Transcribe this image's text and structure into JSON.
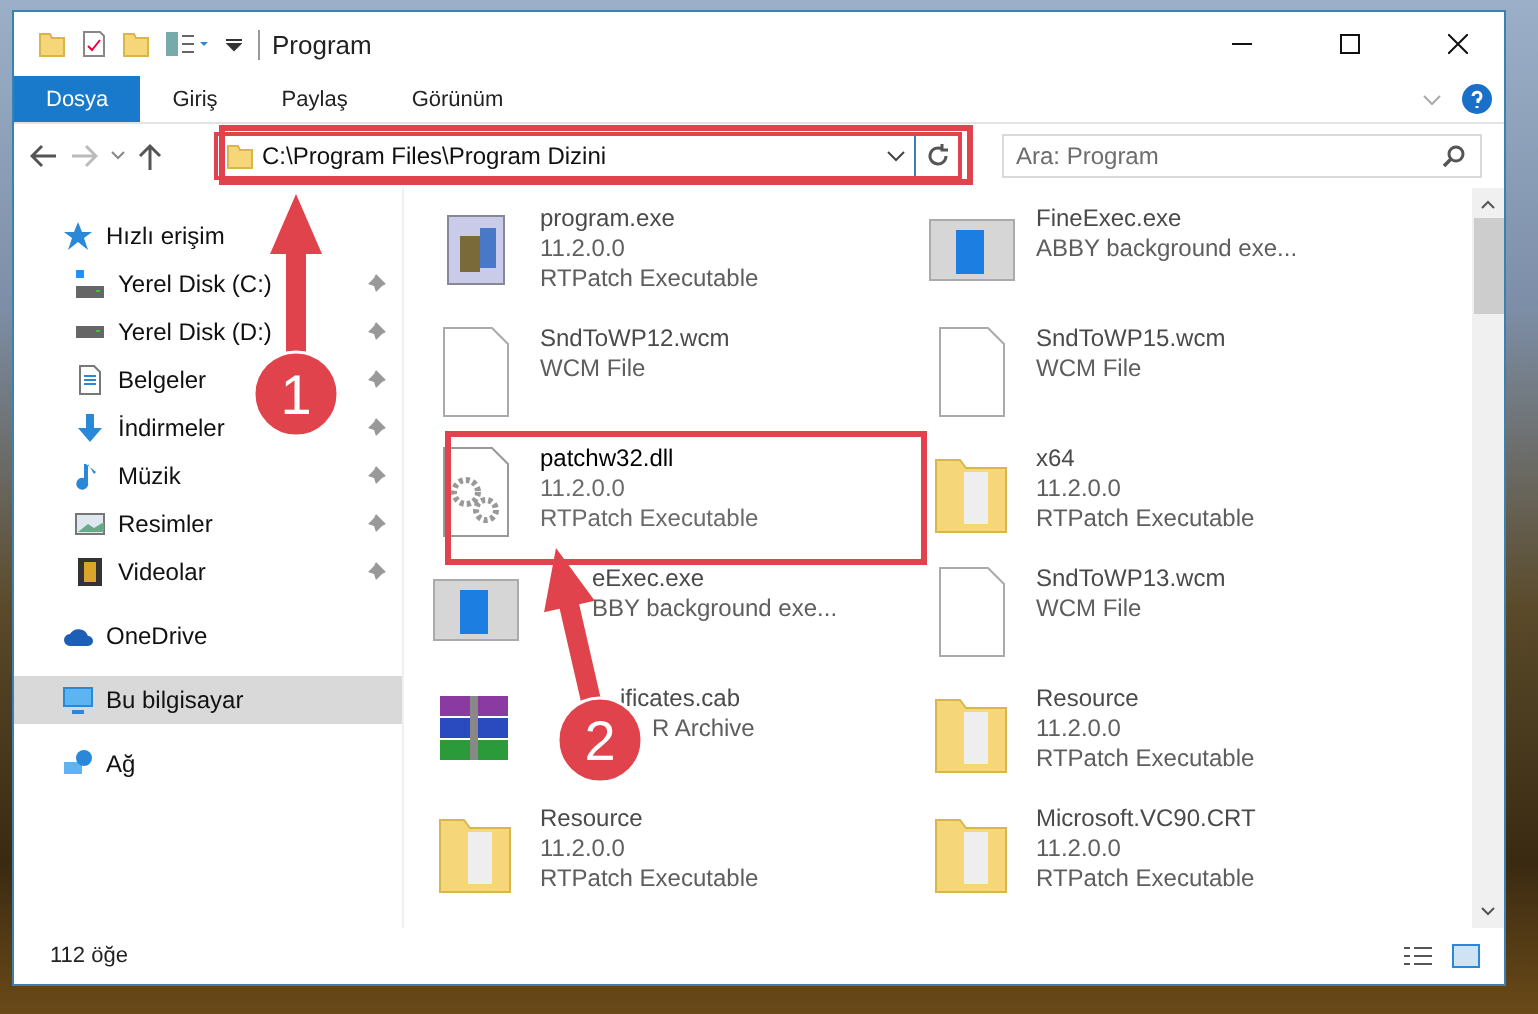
{
  "window": {
    "title": "Program"
  },
  "ribbon_tabs": [
    {
      "label": "Dosya",
      "selected": true
    },
    {
      "label": "Giriş",
      "selected": false
    },
    {
      "label": "Paylaş",
      "selected": false
    },
    {
      "label": "Görünüm",
      "selected": false
    }
  ],
  "address_bar": {
    "path": "C:\\Program Files\\Program Dizini"
  },
  "search": {
    "placeholder": "Ara: Program"
  },
  "sidebar": {
    "items": [
      {
        "label": "Hızlı erişim",
        "kind": "star",
        "selected": false,
        "children": [
          {
            "label": "Yerel Disk (C:)",
            "kind": "system-drive",
            "pinned": true
          },
          {
            "label": "Yerel Disk (D:)",
            "kind": "drive",
            "pinned": true
          },
          {
            "label": "Belgeler",
            "kind": "document",
            "pinned": true
          },
          {
            "label": "İndirmeler",
            "kind": "download",
            "pinned": true
          },
          {
            "label": "Müzik",
            "kind": "music",
            "pinned": true
          },
          {
            "label": "Resimler",
            "kind": "pictures",
            "pinned": true
          },
          {
            "label": "Videolar",
            "kind": "video",
            "pinned": true
          }
        ]
      },
      {
        "label": "OneDrive",
        "kind": "cloud",
        "selected": false
      },
      {
        "label": "Bu bilgisayar",
        "kind": "computer",
        "selected": true
      },
      {
        "label": "Ağ",
        "kind": "network",
        "selected": false
      }
    ]
  },
  "files": [
    {
      "name": "program.exe",
      "details": [
        "11.2.0.0",
        "RTPatch Executable"
      ],
      "kind": "app",
      "blurred": true
    },
    {
      "name": "FineExec.exe",
      "details": [
        "ABBY background exe..."
      ],
      "kind": "window",
      "blurred": true
    },
    {
      "name": "SndToWP12.wcm",
      "details": [
        "WCM File"
      ],
      "kind": "page",
      "blurred": true
    },
    {
      "name": "SndToWP15.wcm",
      "details": [
        "WCM File"
      ],
      "kind": "page",
      "blurred": true
    },
    {
      "name": "patchw32.dll",
      "details": [
        "11.2.0.0",
        "RTPatch Executable"
      ],
      "kind": "dll",
      "blurred": false
    },
    {
      "name": "x64",
      "details": [
        "11.2.0.0",
        "RTPatch Executable"
      ],
      "kind": "folder",
      "blurred": true
    },
    {
      "name": "eExec.exe",
      "details": [
        "BBY background exe..."
      ],
      "kind": "window",
      "blurred": true
    },
    {
      "name": "SndToWP13.wcm",
      "details": [
        "WCM File"
      ],
      "kind": "page",
      "blurred": true
    },
    {
      "name": "ificates.cab",
      "details": [
        "R Archive"
      ],
      "kind": "archive",
      "blurred": true
    },
    {
      "name": "Resource",
      "details": [
        "11.2.0.0",
        "RTPatch Executable"
      ],
      "kind": "folder",
      "blurred": true
    },
    {
      "name": "Resource",
      "details": [
        "11.2.0.0",
        "RTPatch Executable"
      ],
      "kind": "folder",
      "blurred": true
    },
    {
      "name": "Microsoft.VC90.CRT",
      "details": [
        "11.2.0.0",
        "RTPatch Executable"
      ],
      "kind": "folder",
      "blurred": true
    }
  ],
  "status_bar": {
    "count": "112 öğe"
  },
  "callouts": [
    {
      "number": "1"
    },
    {
      "number": "2"
    }
  ]
}
